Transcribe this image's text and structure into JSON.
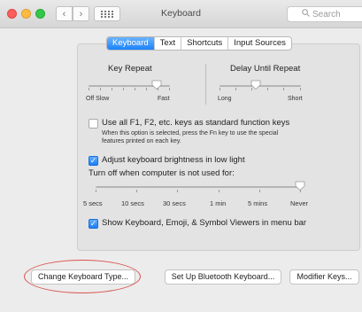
{
  "window": {
    "title": "Keyboard",
    "search_placeholder": "Search"
  },
  "tabs": [
    {
      "label": "Keyboard",
      "active": true
    },
    {
      "label": "Text",
      "active": false
    },
    {
      "label": "Shortcuts",
      "active": false
    },
    {
      "label": "Input Sources",
      "active": false
    }
  ],
  "key_repeat": {
    "title": "Key Repeat",
    "min_label": "Off",
    "min_label2": "Slow",
    "max_label": "Fast",
    "value": 0.85
  },
  "delay": {
    "title": "Delay Until Repeat",
    "min_label": "Long",
    "max_label": "Short",
    "value": 0.45
  },
  "fn_keys": {
    "label": "Use all F1, F2, etc. keys as standard function keys",
    "desc1": "When this option is selected, press the Fn key to use the special",
    "desc2": "features printed on each key.",
    "checked": false
  },
  "brightness": {
    "label": "Adjust keyboard brightness in low light",
    "checked": true
  },
  "turn_off": {
    "label": "Turn off when computer is not used for:",
    "ticks": [
      "5 secs",
      "10 secs",
      "30 secs",
      "1 min",
      "5 mins",
      "Never"
    ],
    "value": 1.0
  },
  "viewers": {
    "label": "Show Keyboard, Emoji, & Symbol Viewers in menu bar",
    "checked": true
  },
  "buttons": {
    "change_type": "Change Keyboard Type...",
    "bluetooth": "Set Up Bluetooth Keyboard...",
    "modifier": "Modifier Keys..."
  },
  "colors": {
    "accent": "#1a82fb",
    "annotation": "#d9534f"
  }
}
